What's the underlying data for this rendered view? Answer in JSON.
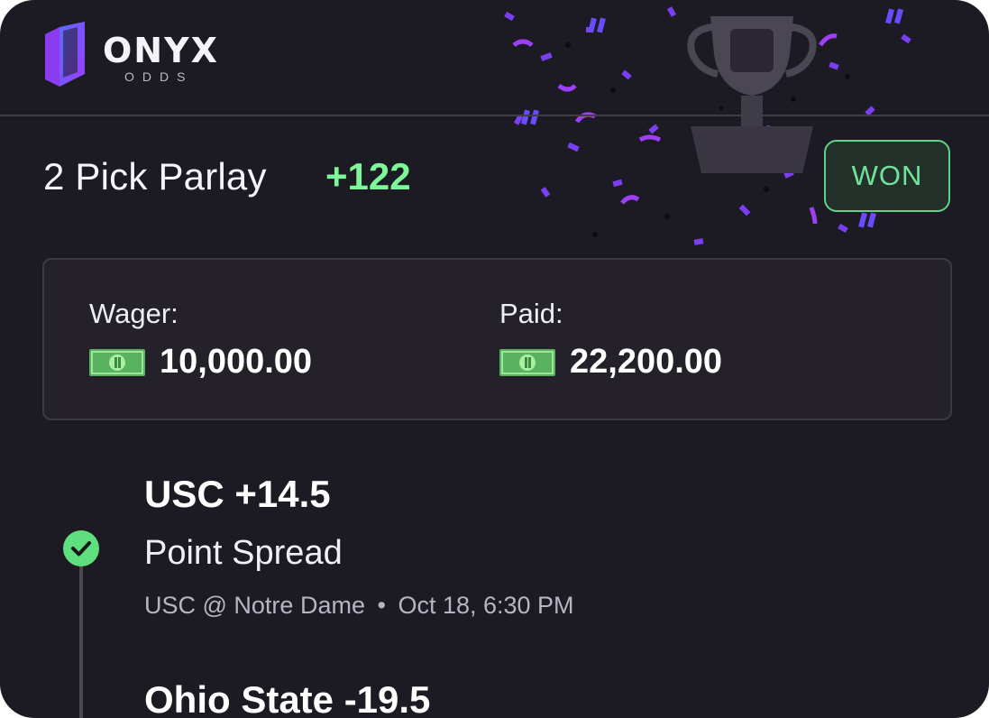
{
  "brand": {
    "name": "ONYX",
    "sub": "ODDS",
    "logo_icon": "onyx-logo-icon"
  },
  "header": {
    "decoration": "trophy-confetti"
  },
  "bet": {
    "title": "2 Pick Parlay",
    "odds": "+122",
    "status": "WON",
    "status_color": "#6fe39a",
    "odds_color": "#7ef79a"
  },
  "summary": {
    "wager_label": "Wager:",
    "wager_value": "10,000.00",
    "paid_label": "Paid:",
    "paid_value": "22,200.00",
    "currency_icon": "cash-bill-icon"
  },
  "picks": [
    {
      "name": "USC +14.5",
      "market": "Point Spread",
      "matchup": "USC @ Notre Dame",
      "separator": "•",
      "time": "Oct 18, 6:30 PM",
      "result_icon": "check-circle-icon"
    },
    {
      "name": "Ohio State -19.5"
    }
  ]
}
